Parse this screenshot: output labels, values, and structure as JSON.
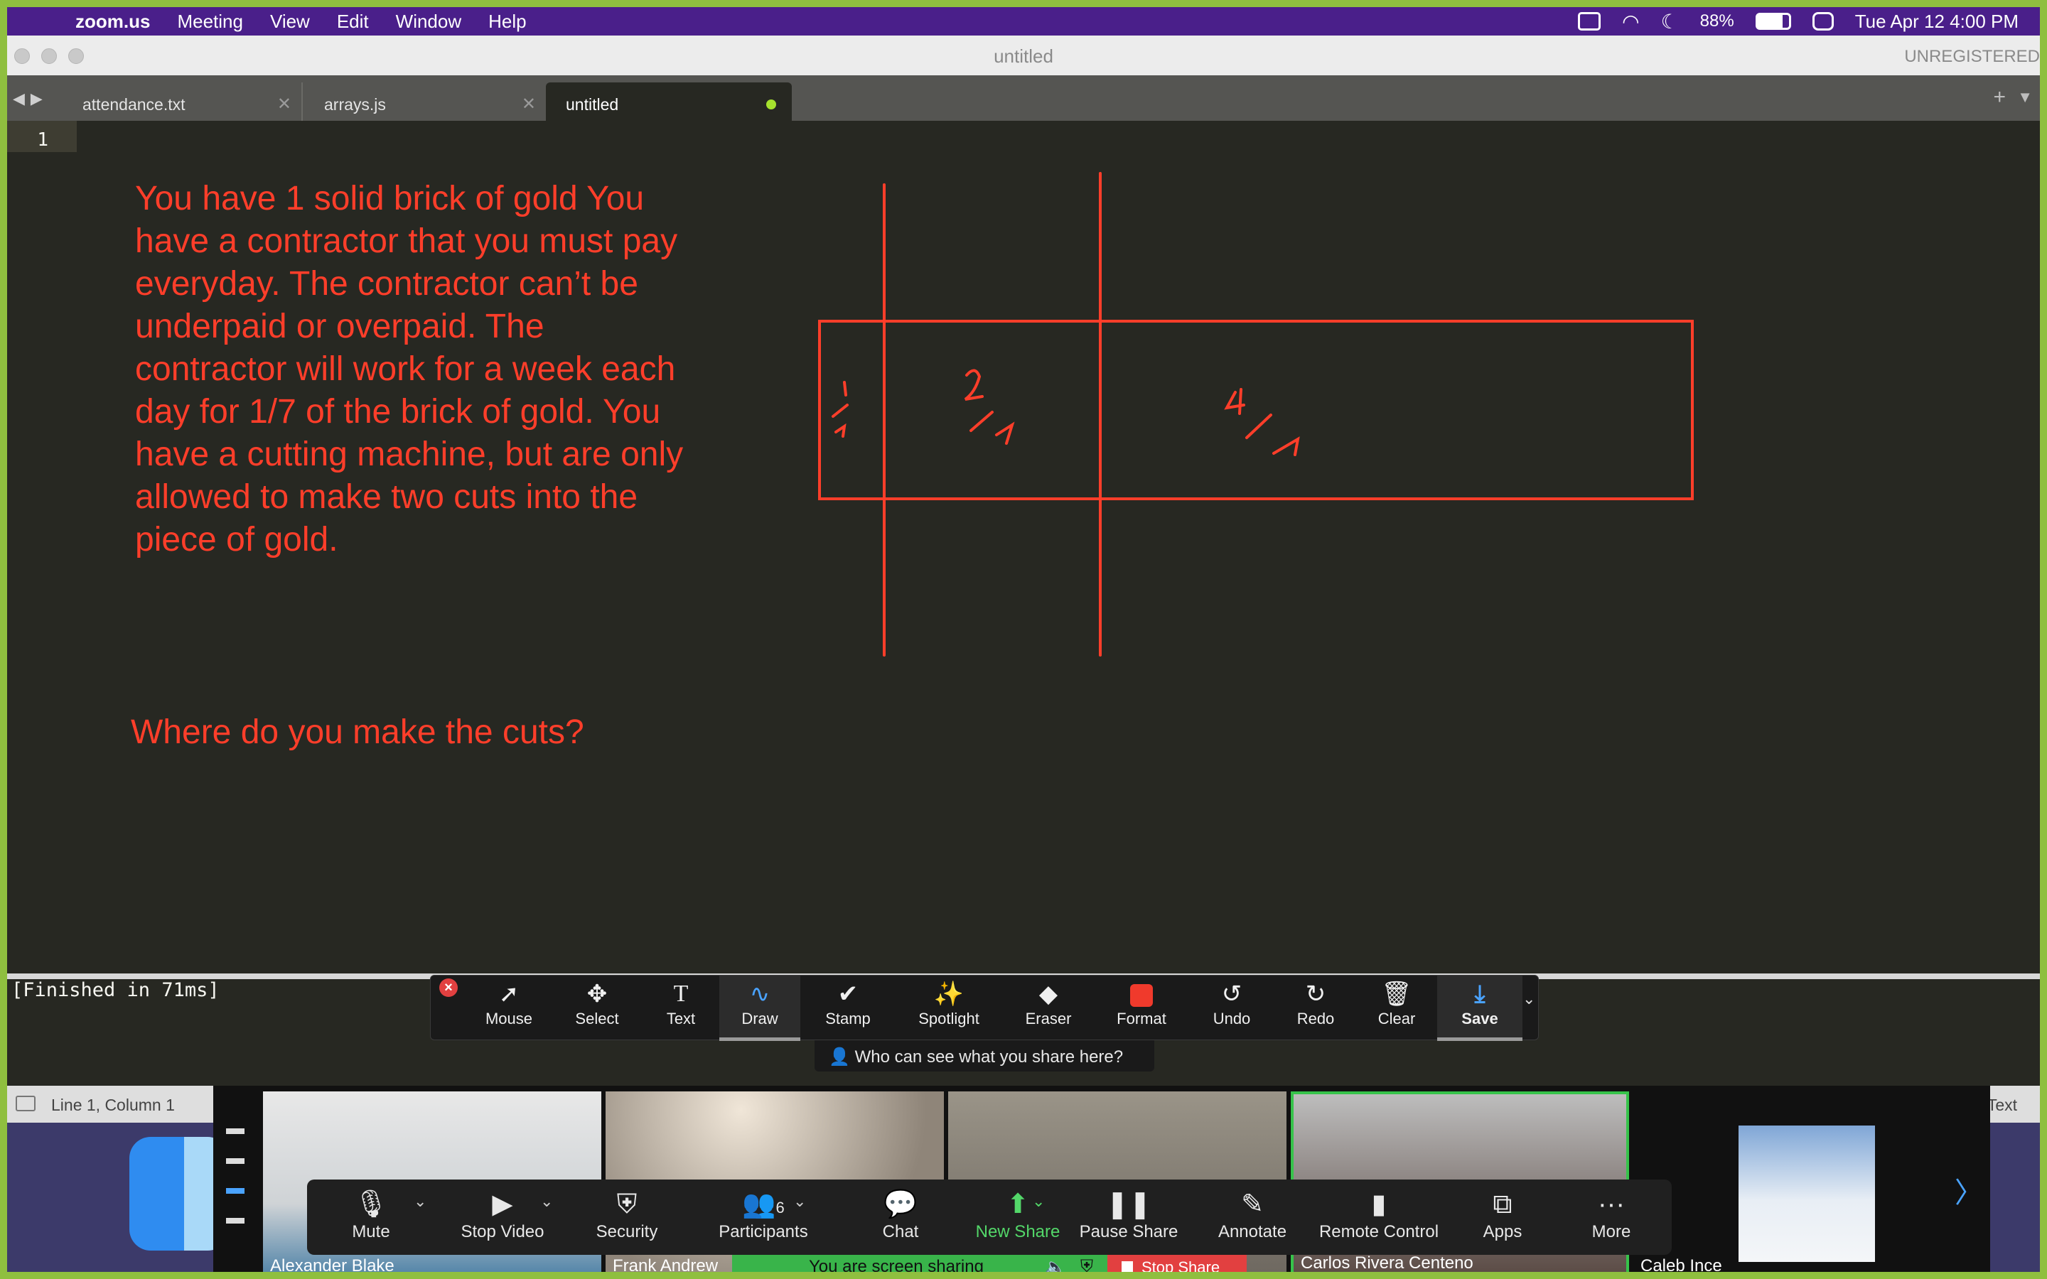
{
  "menubar": {
    "app": "zoom.us",
    "items": [
      "Meeting",
      "View",
      "Edit",
      "Window",
      "Help"
    ],
    "battery": "88%",
    "clock": "Tue Apr 12  4:00 PM"
  },
  "window": {
    "title": "untitled",
    "registration": "UNREGISTERED"
  },
  "tabs": [
    {
      "label": "attendance.txt"
    },
    {
      "label": "arrays.js"
    },
    {
      "label": "untitled",
      "modified": true
    }
  ],
  "editor": {
    "line_number": "1",
    "note": "You have 1 solid brick of gold You have a contractor that you must pay everyday. The contractor can’t be underpaid or overpaid. The contractor will work for a week each day for 1/7 of the brick of gold. You have a cutting machine, but are only allowed to make two cuts into the piece of gold.",
    "question": "Where do you make the cuts?"
  },
  "console": {
    "text": "[Finished in 71ms]"
  },
  "statusbar": {
    "position": "Line 1, Column 1",
    "syntax": "Text"
  },
  "annotation_toolbar": {
    "tools": [
      {
        "label": "Mouse",
        "icon": "arrow-cursor-icon"
      },
      {
        "label": "Select",
        "icon": "move-icon"
      },
      {
        "label": "Text",
        "icon": "text-icon"
      },
      {
        "label": "Draw",
        "icon": "squiggle-icon",
        "selected": true
      },
      {
        "label": "Stamp",
        "icon": "checkmark-icon"
      },
      {
        "label": "Spotlight",
        "icon": "magic-wand-icon"
      },
      {
        "label": "Eraser",
        "icon": "eraser-icon"
      },
      {
        "label": "Format",
        "icon": "red-square-icon"
      },
      {
        "label": "Undo",
        "icon": "undo-icon"
      },
      {
        "label": "Redo",
        "icon": "redo-icon"
      },
      {
        "label": "Clear",
        "icon": "trash-icon"
      },
      {
        "label": "Save",
        "icon": "save-icon"
      }
    ],
    "share_notice": "Who can see what you share here?"
  },
  "participants": [
    {
      "name": "Alexander Blake"
    },
    {
      "name": "Frank Andrew"
    },
    {
      "name": ""
    },
    {
      "name": "Carlos Rivera Centeno",
      "speaking": true
    },
    {
      "name": "Caleb Ince"
    }
  ],
  "meeting_controls": [
    {
      "label": "Mute",
      "icon": "microphone-icon"
    },
    {
      "label": "Stop Video",
      "icon": "video-camera-icon"
    },
    {
      "label": "Security",
      "icon": "shield-icon"
    },
    {
      "label": "Participants",
      "icon": "people-icon",
      "count": "6"
    },
    {
      "label": "Chat",
      "icon": "chat-bubble-icon"
    },
    {
      "label": "New Share",
      "icon": "share-arrow-icon",
      "active": true
    },
    {
      "label": "Pause Share",
      "icon": "pause-icon"
    },
    {
      "label": "Annotate",
      "icon": "pencil-icon"
    },
    {
      "label": "Remote Control",
      "icon": "mouse-icon"
    },
    {
      "label": "Apps",
      "icon": "apps-icon"
    },
    {
      "label": "More",
      "icon": "ellipsis-icon"
    }
  ],
  "share_status": {
    "text": "You are screen sharing",
    "stop": "Stop Share"
  },
  "drawing": {
    "labels": [
      "1/7",
      "2/7",
      "4/7"
    ],
    "color": "#ff3e2a"
  }
}
